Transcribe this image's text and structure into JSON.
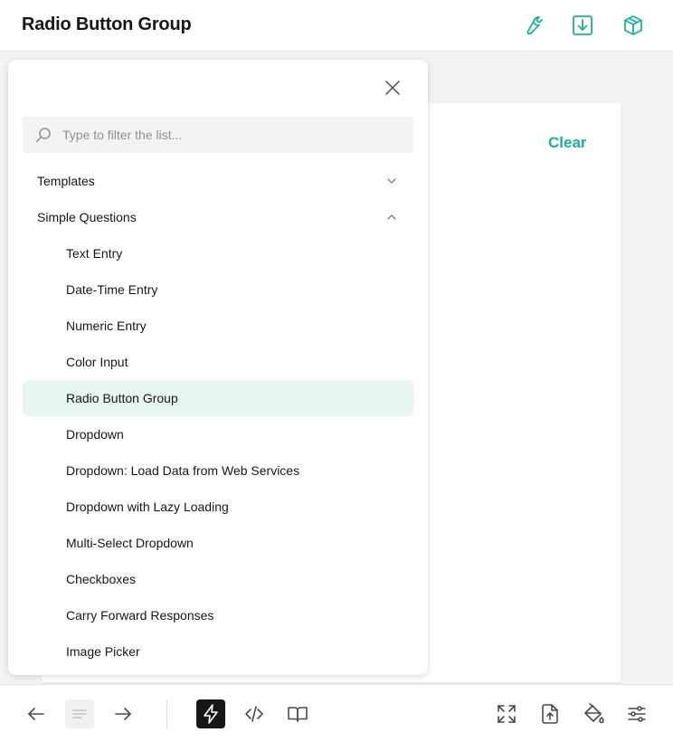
{
  "header": {
    "title": "Radio Button Group",
    "icons": [
      "wrench-icon",
      "download-icon",
      "package-icon"
    ]
  },
  "preview": {
    "clear_label": "Clear"
  },
  "panel": {
    "search_placeholder": "Type to filter the list...",
    "groups": [
      {
        "label": "Templates",
        "expanded": false
      },
      {
        "label": "Simple Questions",
        "expanded": true
      }
    ],
    "items": [
      {
        "label": "Text Entry"
      },
      {
        "label": "Date-Time Entry"
      },
      {
        "label": "Numeric Entry"
      },
      {
        "label": "Color Input"
      },
      {
        "label": "Radio Button Group",
        "selected": true
      },
      {
        "label": "Dropdown"
      },
      {
        "label": "Dropdown: Load Data from Web Services"
      },
      {
        "label": "Dropdown with Lazy Loading"
      },
      {
        "label": "Multi-Select Dropdown"
      },
      {
        "label": "Checkboxes"
      },
      {
        "label": "Carry Forward Responses"
      },
      {
        "label": "Image Picker"
      }
    ]
  },
  "footer": {
    "icons": [
      "arrow-left-icon",
      "list-icon",
      "arrow-right-icon",
      "lightning-icon",
      "code-icon",
      "book-icon",
      "expand-icon",
      "upload-icon",
      "paint-bucket-icon",
      "settings-sliders-icon"
    ]
  },
  "colors": {
    "accent": "#19b394",
    "selected_bg": "#e8f6f1",
    "text": "#161616"
  }
}
